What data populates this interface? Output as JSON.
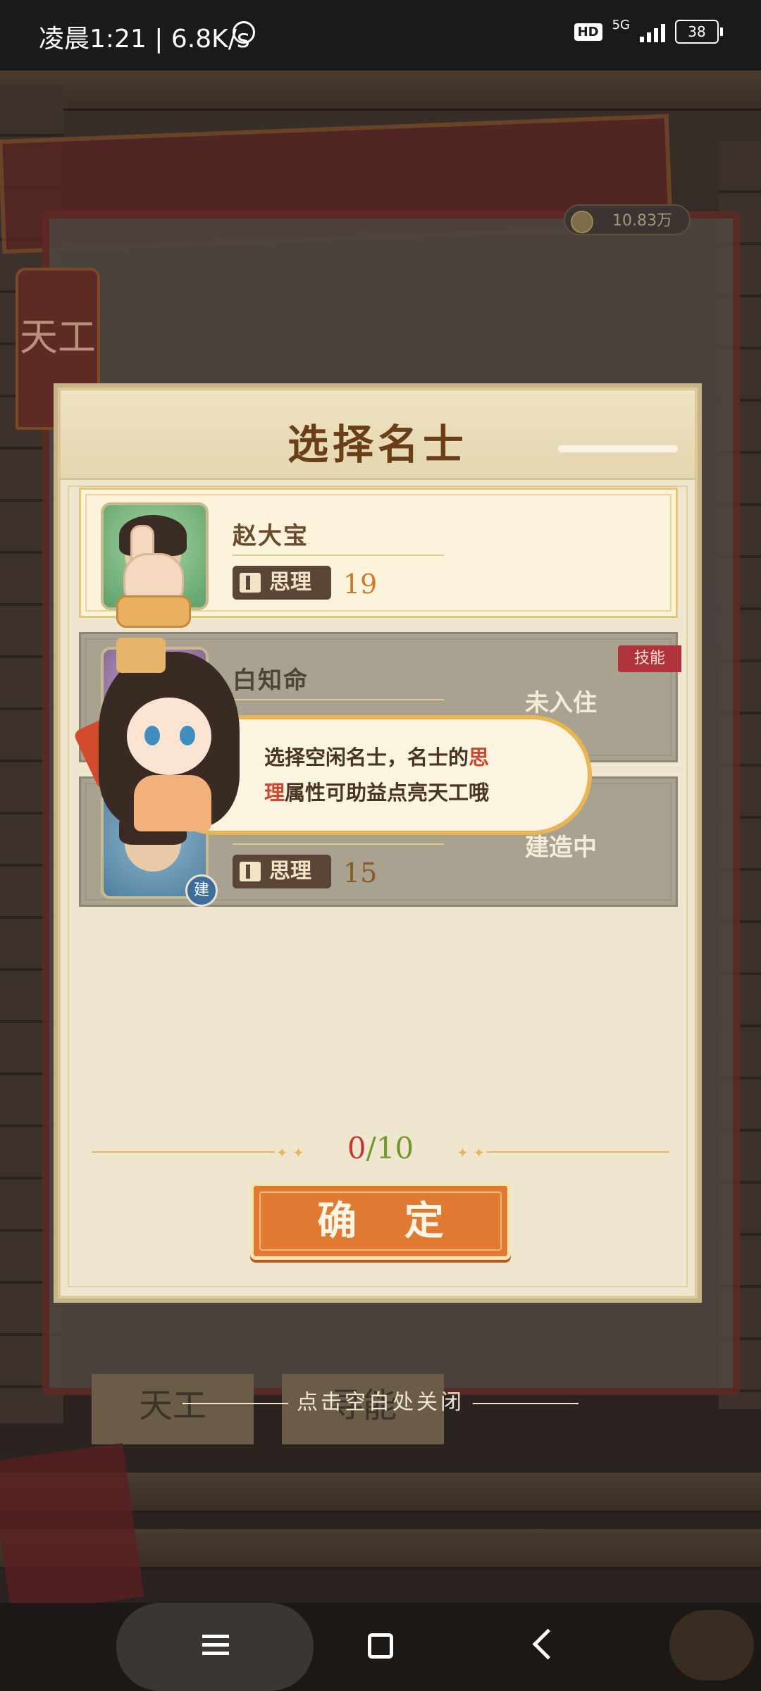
{
  "status_bar": {
    "time_speed": "凌晨1:21 | 6.8K/s",
    "hd": "HD",
    "net": "5G",
    "battery": "38"
  },
  "background": {
    "coins": "10.83万",
    "side_tag": "天工",
    "tab_left": "天工",
    "tab_right": "寻能"
  },
  "dialog": {
    "title": "选择名士",
    "candidates": [
      {
        "name": "赵大宝",
        "attr_label": "思理",
        "attr_value": "19",
        "status": "",
        "selected": true
      },
      {
        "name": "白知命",
        "attr_label": "思理",
        "attr_value": "",
        "status": "未入住",
        "skill_tag": "技能"
      },
      {
        "name": "",
        "attr_label": "思理",
        "attr_value": "15",
        "status": "建造中",
        "badge": "建"
      }
    ],
    "counter_current": "0",
    "counter_sep": "/",
    "counter_max": "10",
    "confirm_label": "确 定"
  },
  "tutorial": {
    "text_before": "选择空闲名士，名士的",
    "text_highlight": "思理",
    "text_after": "属性可助益点亮天工哦"
  },
  "close_hint": "点击空白处关闭",
  "colors": {
    "accent_orange": "#e07a32",
    "title_brown": "#6b3e1a",
    "counter_red": "#c13a2e",
    "counter_green": "#6f9a2a"
  }
}
